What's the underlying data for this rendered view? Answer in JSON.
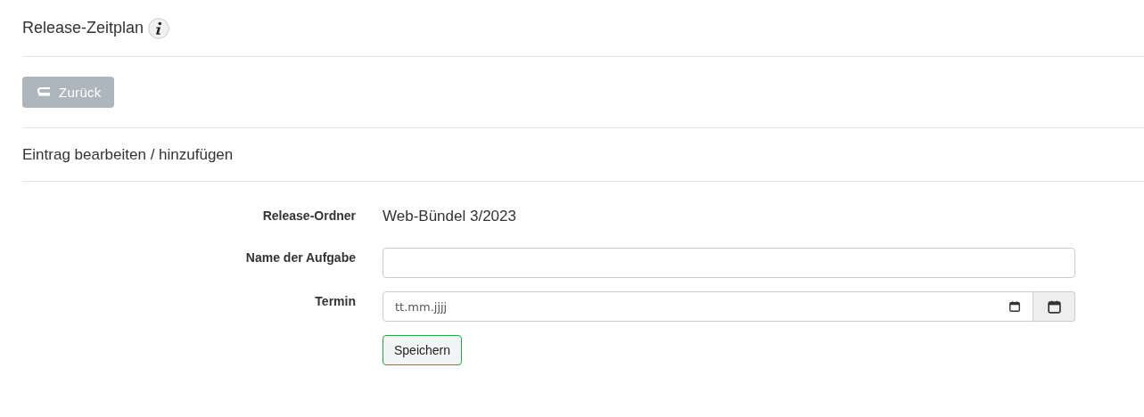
{
  "page": {
    "title": "Release-Zeitplan"
  },
  "back_button": {
    "label": "Zurück",
    "disabled": true
  },
  "section": {
    "title": "Eintrag bearbeiten / hinzufügen"
  },
  "form": {
    "fields": [
      {
        "kind": "static",
        "label": "Release-Ordner",
        "value": "Web-Bündel 3/2023"
      },
      {
        "kind": "text",
        "label": "Name der Aufgabe"
      },
      {
        "kind": "date",
        "label": "Termin",
        "placeholder": "tt.mm.jjjj"
      }
    ],
    "submit": {
      "label": "Speichern"
    }
  }
}
